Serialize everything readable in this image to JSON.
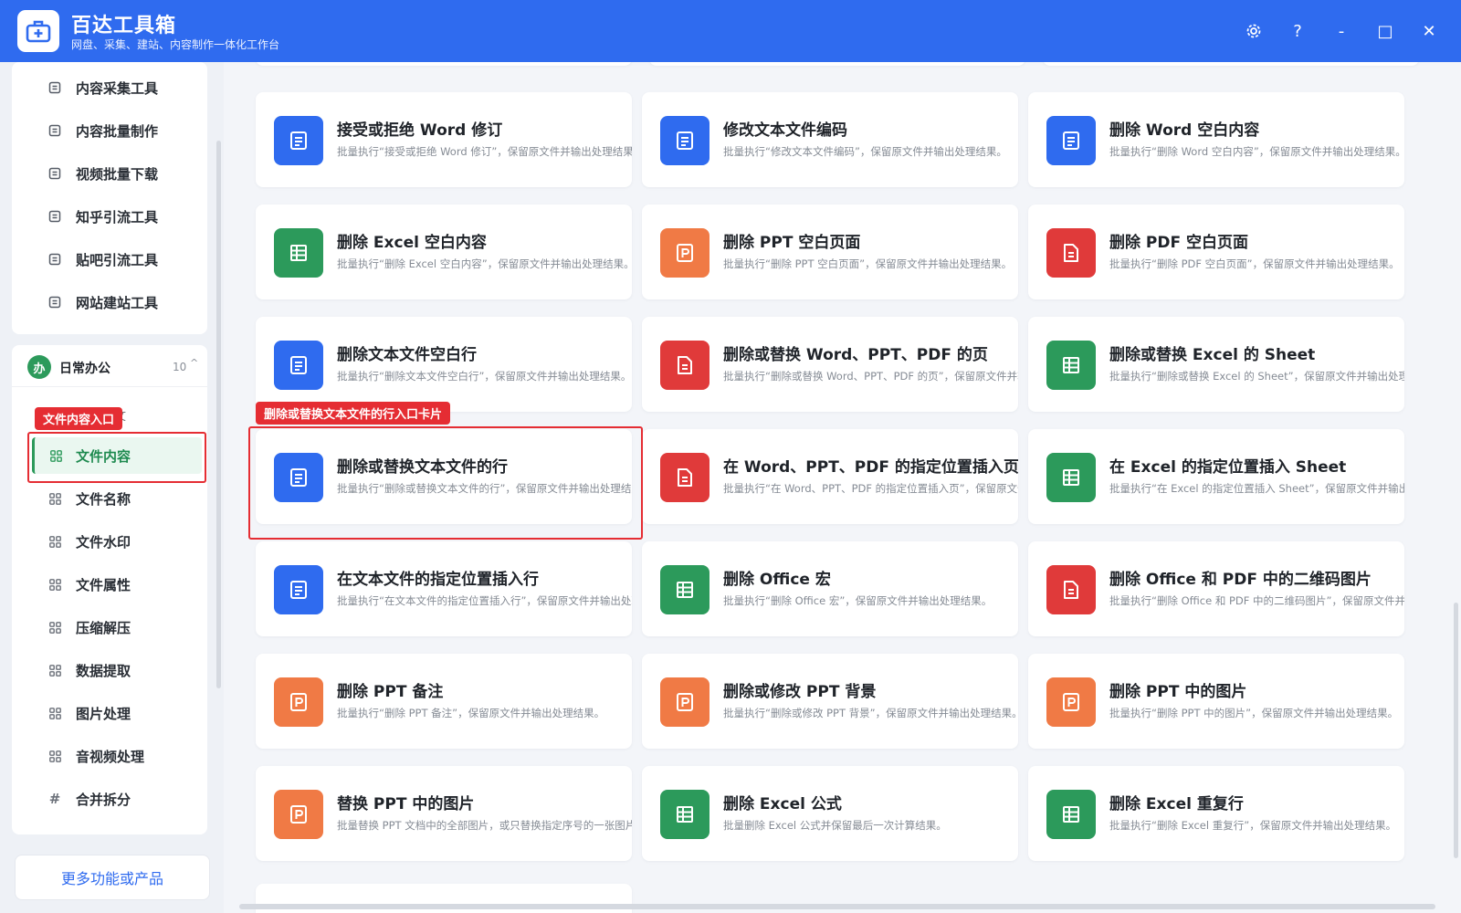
{
  "app": {
    "title": "百达工具箱",
    "subtitle": "网盘、采集、建站、内容制作一体化工作台"
  },
  "window_controls": {
    "settings": "⚙",
    "help": "?",
    "minimize": "-",
    "maximize": "□",
    "close": "✕"
  },
  "sidebar": {
    "top_items": [
      {
        "label": "内容采集工具",
        "icon": "clipboard-icon"
      },
      {
        "label": "内容批量制作",
        "icon": "pen-icon"
      },
      {
        "label": "视频批量下载",
        "icon": "video-icon"
      },
      {
        "label": "知乎引流工具",
        "icon": "zhihu-icon"
      },
      {
        "label": "贴吧引流工具",
        "icon": "forum-icon"
      },
      {
        "label": "网站建站工具",
        "icon": "globe-icon"
      }
    ],
    "group": {
      "badge": "办",
      "title": "日常办公",
      "count": "10",
      "caret": "^",
      "partial_label": "文"
    },
    "group_items": [
      {
        "label": "文件内容",
        "icon": "grid-icon"
      },
      {
        "label": "文件名称",
        "icon": "grid-icon"
      },
      {
        "label": "文件水印",
        "icon": "grid-icon"
      },
      {
        "label": "文件属性",
        "icon": "grid-icon"
      },
      {
        "label": "压缩解压",
        "icon": "grid-icon"
      },
      {
        "label": "数据提取",
        "icon": "grid-icon"
      },
      {
        "label": "图片处理",
        "icon": "grid-icon"
      },
      {
        "label": "音视频处理",
        "icon": "grid-icon"
      },
      {
        "label": "合并拆分",
        "icon": "hash-icon"
      }
    ],
    "more": "更多功能或产品"
  },
  "annotations": {
    "sidebar_tag": "文件内容入口",
    "card_tag": "删除或替换文本文件的行入口卡片"
  },
  "cards": [
    {
      "title": "接受或拒绝 Word 修订",
      "desc": "批量执行“接受或拒绝 Word 修订”，保留原文件并输出处理结果。",
      "color": "#2f6bef",
      "icon": "doc-icon"
    },
    {
      "title": "修改文本文件编码",
      "desc": "批量执行“修改文本文件编码”，保留原文件并输出处理结果。",
      "color": "#2f6bef",
      "icon": "doc-icon"
    },
    {
      "title": "删除 Word 空白内容",
      "desc": "批量执行“删除 Word 空白内容”，保留原文件并输出处理结果。",
      "color": "#2f6bef",
      "icon": "doc-icon"
    },
    {
      "title": "删除 Excel 空白内容",
      "desc": "批量执行“删除 Excel 空白内容”，保留原文件并输出处理结果。",
      "color": "#2c9a5b",
      "icon": "sheet-icon"
    },
    {
      "title": "删除 PPT 空白页面",
      "desc": "批量执行“删除 PPT 空白页面”，保留原文件并输出处理结果。",
      "color": "#f07a45",
      "icon": "ppt-icon"
    },
    {
      "title": "删除 PDF 空白页面",
      "desc": "批量执行“删除 PDF 空白页面”，保留原文件并输出处理结果。",
      "color": "#e03a3a",
      "icon": "pdf-icon"
    },
    {
      "title": "删除文本文件空白行",
      "desc": "批量执行“删除文本文件空白行”，保留原文件并输出处理结果。",
      "color": "#2f6bef",
      "icon": "doc-icon"
    },
    {
      "title": "删除或替换 Word、PPT、PDF 的页",
      "desc": "批量执行“删除或替换 Word、PPT、PDF 的页”，保留原文件并输出处理结果。",
      "color": "#e03a3a",
      "icon": "pdf-icon"
    },
    {
      "title": "删除或替换 Excel 的 Sheet",
      "desc": "批量执行“删除或替换 Excel 的 Sheet”，保留原文件并输出处理结果。",
      "color": "#2c9a5b",
      "icon": "sheet-icon"
    },
    {
      "title": "删除或替换文本文件的行",
      "desc": "批量执行“删除或替换文本文件的行”，保留原文件并输出处理结果。",
      "color": "#2f6bef",
      "icon": "doc-icon"
    },
    {
      "title": "在 Word、PPT、PDF 的指定位置插入页",
      "desc": "批量执行“在 Word、PPT、PDF 的指定位置插入页”，保留原文件并输出处理结果。",
      "color": "#e03a3a",
      "icon": "pdf-icon"
    },
    {
      "title": "在 Excel 的指定位置插入 Sheet",
      "desc": "批量执行“在 Excel 的指定位置插入 Sheet”，保留原文件并输出处理结果。",
      "color": "#2c9a5b",
      "icon": "sheet-icon"
    },
    {
      "title": "在文本文件的指定位置插入行",
      "desc": "批量执行“在文本文件的指定位置插入行”，保留原文件并输出处理结果。",
      "color": "#2f6bef",
      "icon": "doc-icon"
    },
    {
      "title": "删除 Office 宏",
      "desc": "批量执行“删除 Office 宏”，保留原文件并输出处理结果。",
      "color": "#2c9a5b",
      "icon": "sheet-icon"
    },
    {
      "title": "删除 Office 和 PDF 中的二维码图片",
      "desc": "批量执行“删除 Office 和 PDF 中的二维码图片”，保留原文件并输出处理结果。",
      "color": "#e03a3a",
      "icon": "pdf-icon"
    },
    {
      "title": "删除 PPT 备注",
      "desc": "批量执行“删除 PPT 备注”，保留原文件并输出处理结果。",
      "color": "#f07a45",
      "icon": "ppt-icon"
    },
    {
      "title": "删除或修改 PPT 背景",
      "desc": "批量执行“删除或修改 PPT 背景”，保留原文件并输出处理结果。",
      "color": "#f07a45",
      "icon": "ppt-icon"
    },
    {
      "title": "删除 PPT 中的图片",
      "desc": "批量执行“删除 PPT 中的图片”，保留原文件并输出处理结果。",
      "color": "#f07a45",
      "icon": "ppt-icon"
    },
    {
      "title": "替换 PPT 中的图片",
      "desc": "批量替换 PPT 文档中的全部图片，或只替换指定序号的一张图片。",
      "color": "#f07a45",
      "icon": "ppt-icon"
    },
    {
      "title": "删除 Excel 公式",
      "desc": "批量删除 Excel 公式并保留最后一次计算结果。",
      "color": "#2c9a5b",
      "icon": "sheet-icon"
    },
    {
      "title": "删除 Excel 重复行",
      "desc": "批量执行“删除 Excel 重复行”，保留原文件并输出处理结果。",
      "color": "#2c9a5b",
      "icon": "sheet-icon"
    }
  ]
}
